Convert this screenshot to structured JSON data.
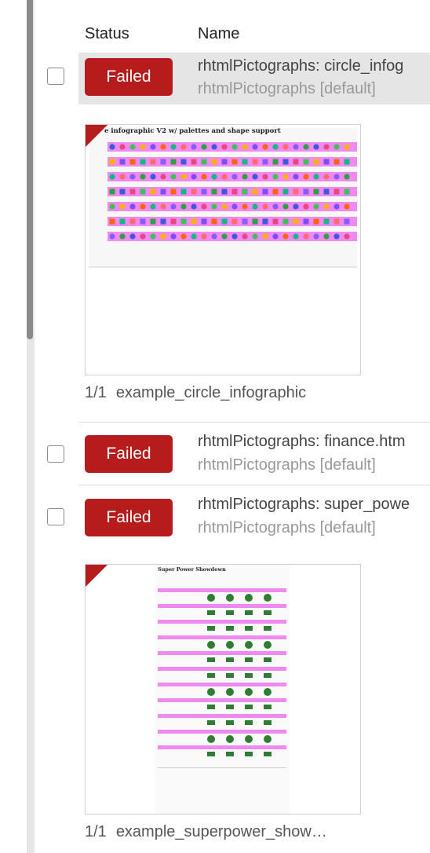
{
  "table": {
    "columns": {
      "status": "Status",
      "name": "Name"
    }
  },
  "rows": [
    {
      "status": "Failed",
      "name": "rhtmlPictographs: circle_infog",
      "sub": "rhtmlPictographs [default]"
    },
    {
      "status": "Failed",
      "name": "rhtmlPictographs: finance.htm",
      "sub": "rhtmlPictographs [default]"
    },
    {
      "status": "Failed",
      "name": "rhtmlPictographs: super_powe",
      "sub": "rhtmlPictographs [default]"
    }
  ],
  "snapshots": [
    {
      "counter": "1/1",
      "label": "example_circle_infographic",
      "thumb_title": "e infographic V2 w/ palettes and shape support"
    },
    {
      "counter": "1/1",
      "label": "example_superpower_show…",
      "thumb_title": "Super Power Showdown"
    }
  ],
  "colors": {
    "failed": "#b71c1c",
    "selected_row": "#e5e5e5",
    "scroll_thumb": "#8a8a8a"
  }
}
